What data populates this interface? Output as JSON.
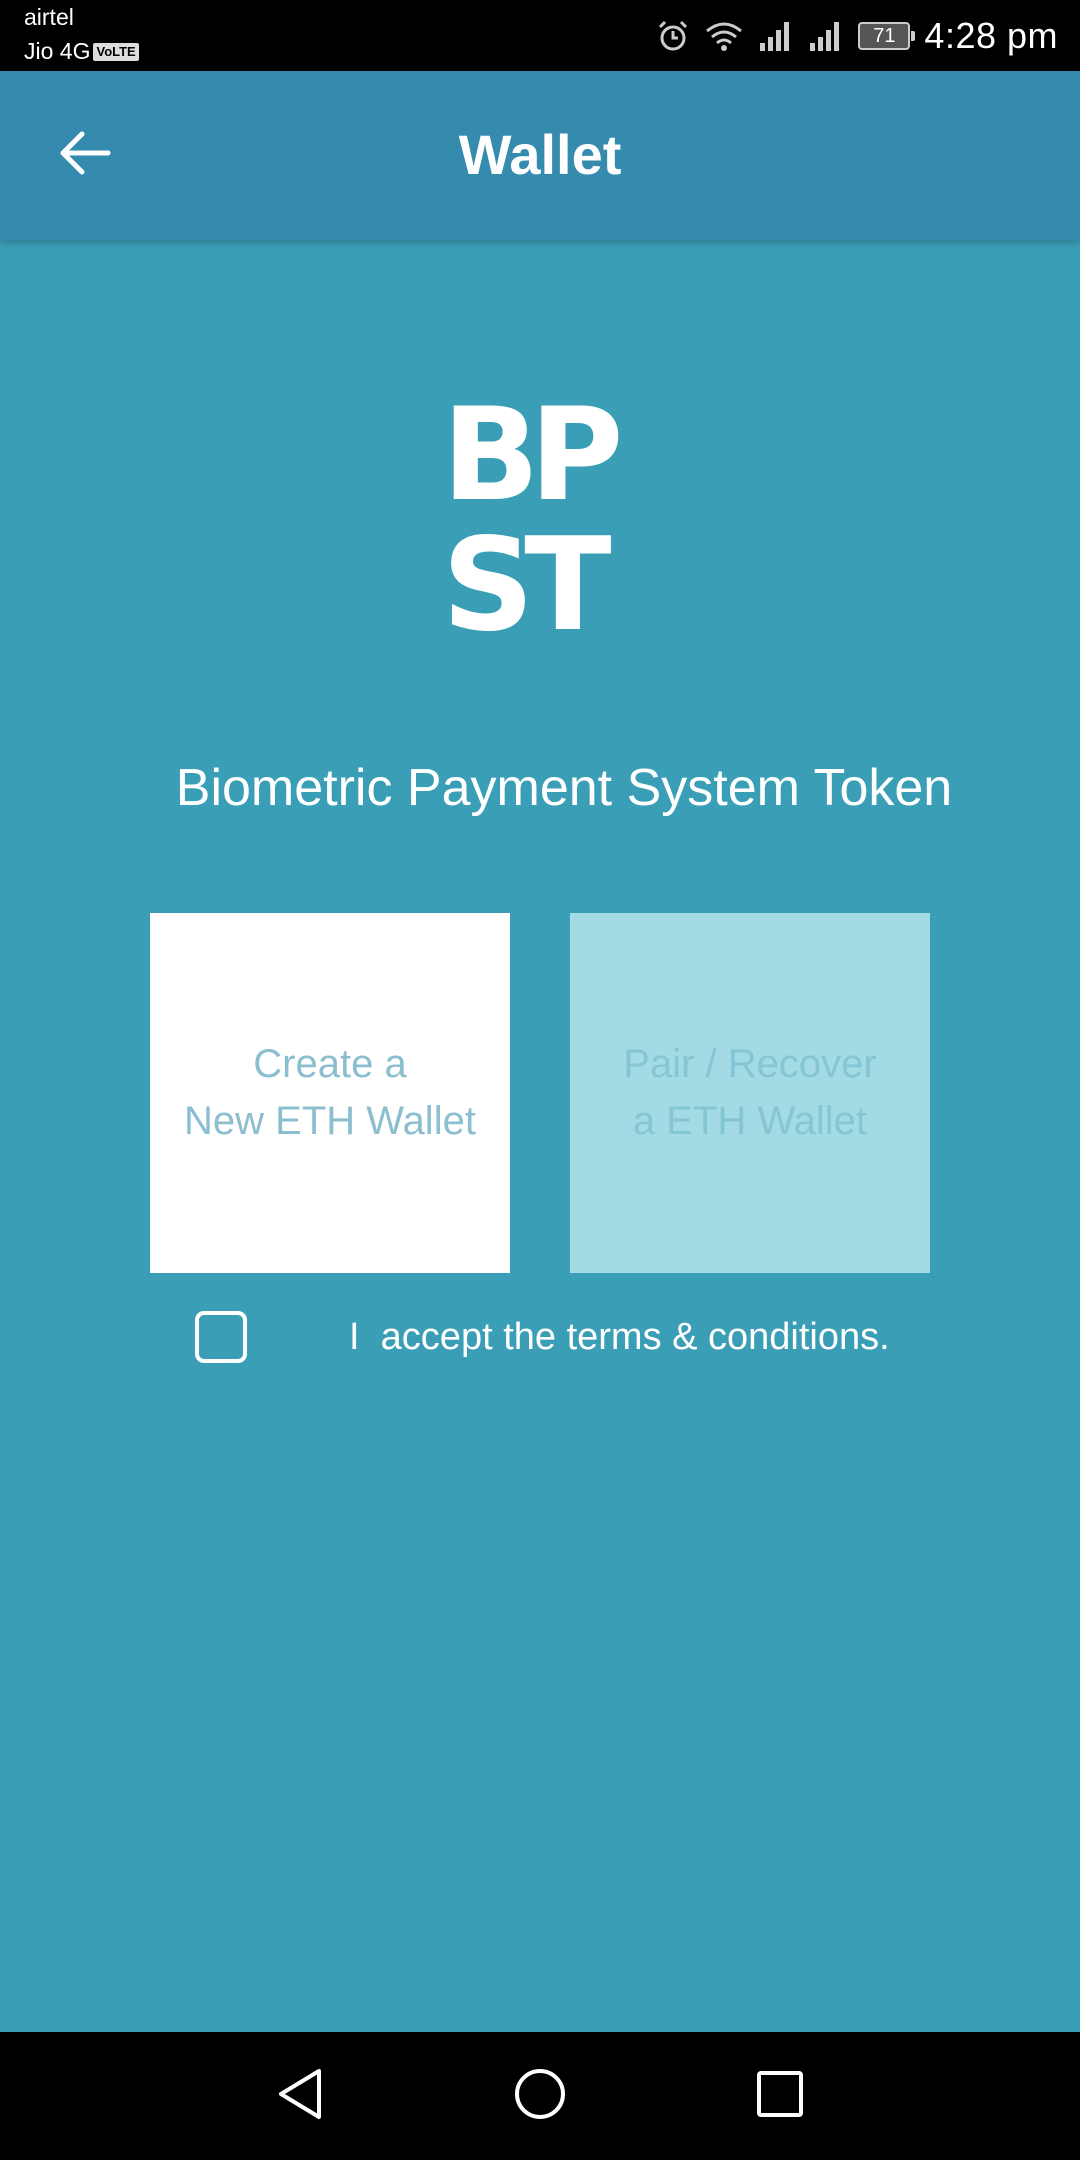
{
  "status_bar": {
    "carrier_1": "airtel",
    "carrier_2": "Jio 4G",
    "volte_badge": "VoLTE",
    "battery_level": "71",
    "time": "4:28 pm"
  },
  "app_bar": {
    "title": "Wallet",
    "back_icon": "arrow-left-icon"
  },
  "logo": {
    "line1": "BP",
    "line2": "ST"
  },
  "subtitle": "Biometric Payment System Token",
  "cards": {
    "create": "Create a\nNew ETH Wallet",
    "pair": "Pair / Recover\na ETH Wallet"
  },
  "terms": {
    "label": "I  accept the terms & conditions.",
    "checked": false
  },
  "nav_bar": {
    "back_icon": "triangle-back-icon",
    "home_icon": "circle-home-icon",
    "recent_icon": "square-recent-icon"
  },
  "colors": {
    "background": "#3a9fb6",
    "app_bar": "#358bae",
    "card_create": "#ffffff",
    "card_pair": "#a3dbe4",
    "text_primary": "#ffffff"
  }
}
